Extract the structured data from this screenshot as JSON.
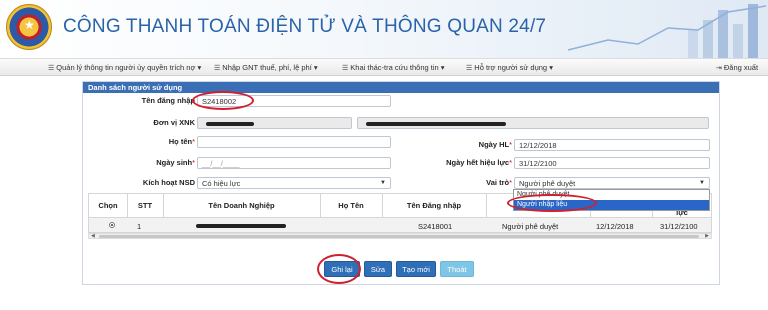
{
  "header": {
    "title": "CÔNG THANH TOÁN ĐIỆN TỬ VÀ THÔNG QUAN 24/7",
    "logo_icon": "customs-emblem-icon"
  },
  "nav": {
    "items": [
      {
        "label": "Quản lý thông tin người ủy quyền trích nợ ▾",
        "icon": "list-icon"
      },
      {
        "label": "Nhập GNT thuế, phí, lệ phí ▾",
        "icon": "list-icon"
      },
      {
        "label": "Khai thác-tra cứu thông tin ▾",
        "icon": "list-icon"
      },
      {
        "label": "Hỗ trợ người sử dụng ▾",
        "icon": "list-icon"
      }
    ],
    "logout": "Đăng xuất"
  },
  "panel": {
    "title": "Danh sách người sử dụng"
  },
  "form": {
    "username_label": "Tên đăng nhập",
    "username_value": "S2418002",
    "unit_label": "Đơn vị XNK",
    "fullname_label": "Họ tên",
    "dob_label": "Ngày sinh",
    "dob_placeholder": "__/__/____",
    "active_label": "Kích hoạt NSD",
    "active_value": "Có hiệu lực",
    "effective_label": "Ngày HL",
    "effective_value": "12/12/2018",
    "expiry_label": "Ngày hết hiệu lực",
    "expiry_value": "31/12/2100",
    "role_label": "Vai trò",
    "role_value": "Người phê duyệt",
    "role_options": [
      "Người phê duyệt",
      "Người nhập liệu"
    ]
  },
  "table": {
    "headers": [
      "Chọn",
      "STT",
      "Tên Doanh Nghiệp",
      "Họ Tên",
      "Tên Đăng nhập",
      "",
      "",
      "lực"
    ],
    "rows": [
      {
        "stt": "1",
        "username": "S2418001",
        "role": "Người phê duyệt",
        "from": "12/12/2018",
        "to": "31/12/2100"
      }
    ]
  },
  "buttons": {
    "save": "Ghi lại",
    "edit": "Sửa",
    "new": "Tạo mới",
    "exit": "Thoát"
  },
  "colors": {
    "accent": "#2f6fb8",
    "panel_header": "#3b6fb5",
    "annotation": "#d02030"
  }
}
